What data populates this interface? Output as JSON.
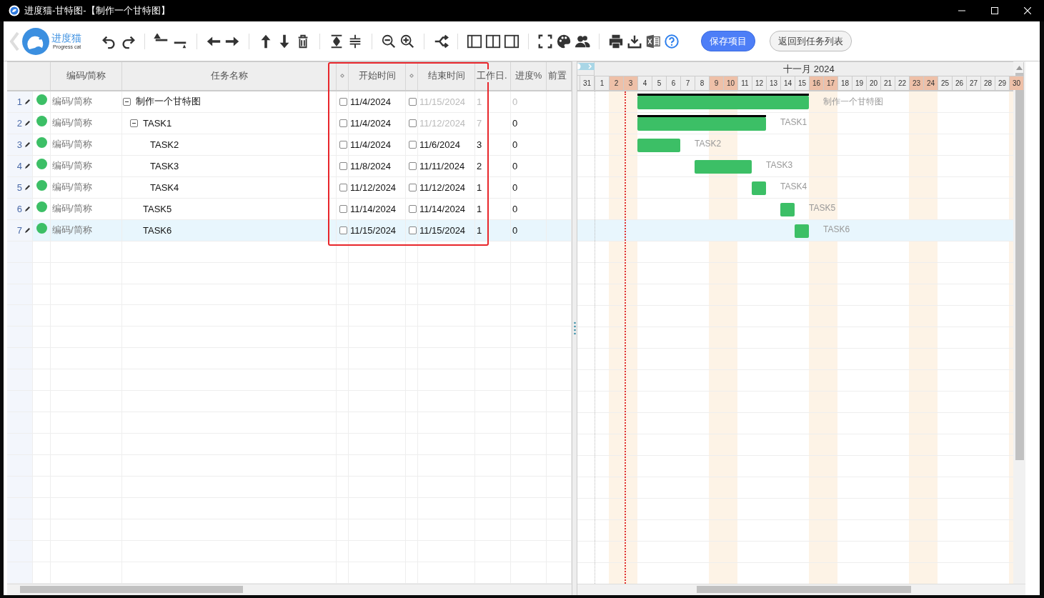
{
  "window": {
    "title": "进度猫-甘特图-【制作一个甘特图】"
  },
  "logo": {
    "name": "进度猫",
    "tagline": "Progress cat"
  },
  "buttons": [
    {
      "label": "保存项目",
      "kind": "primary"
    },
    {
      "label": "返回到任务列表",
      "kind": "secondary"
    }
  ],
  "columns": [
    "编码/简称",
    "任务名称",
    "开始时间",
    "结束时间",
    "工作日.",
    "进度%",
    "前置"
  ],
  "tasks": [
    {
      "no": "1",
      "code": "编码/简称",
      "name": "制作一个甘特图",
      "expanded": true,
      "selected": false,
      "start_checked": false,
      "start": "11/4/2024",
      "end_checked": false,
      "end": "11/15/2024",
      "workdays": "1",
      "progress": "0",
      "computed": true,
      "progress_muted": true,
      "bar_label": "制作一个甘特图",
      "children": [
        {
          "no": "2",
          "code": "编码/简称",
          "name": "TASK1",
          "expanded": true,
          "selected": false,
          "start_checked": false,
          "start": "11/4/2024",
          "end_checked": false,
          "end": "11/12/2024",
          "workdays": "7",
          "progress": "0",
          "computed": true,
          "progress_muted": false,
          "bar_label": "TASK1",
          "children": [
            {
              "no": "3",
              "code": "编码/简称",
              "name": "TASK2",
              "selected": false,
              "start_checked": false,
              "start": "11/4/2024",
              "end_checked": false,
              "end": "11/6/2024",
              "workdays": "3",
              "progress": "0",
              "computed": false,
              "progress_muted": false,
              "bar_label": "TASK2"
            },
            {
              "no": "4",
              "code": "编码/简称",
              "name": "TASK3",
              "selected": false,
              "start_checked": false,
              "start": "11/8/2024",
              "end_checked": false,
              "end": "11/11/2024",
              "workdays": "2",
              "progress": "0",
              "computed": false,
              "progress_muted": false,
              "bar_label": "TASK3"
            },
            {
              "no": "5",
              "code": "编码/简称",
              "name": "TASK4",
              "selected": false,
              "start_checked": false,
              "start": "11/12/2024",
              "end_checked": false,
              "end": "11/12/2024",
              "workdays": "1",
              "progress": "0",
              "computed": false,
              "progress_muted": false,
              "bar_label": "TASK4"
            }
          ]
        },
        {
          "no": "6",
          "code": "编码/简称",
          "name": "TASK5",
          "selected": false,
          "start_checked": false,
          "start": "11/14/2024",
          "end_checked": false,
          "end": "11/14/2024",
          "workdays": "1",
          "progress": "0",
          "computed": false,
          "progress_muted": false,
          "bar_label": "TASK5"
        },
        {
          "no": "7",
          "code": "编码/简称",
          "name": "TASK6",
          "selected": true,
          "start_checked": false,
          "start": "11/15/2024",
          "end_checked": false,
          "end": "11/15/2024",
          "workdays": "1",
          "progress": "0",
          "computed": false,
          "progress_muted": false,
          "bar_label": "TASK6"
        }
      ]
    }
  ],
  "timeline": {
    "month": "十一月 2024",
    "days": [
      {
        "label": "31",
        "weekend": false
      },
      {
        "label": "1",
        "weekend": false
      },
      {
        "label": "2",
        "weekend": true
      },
      {
        "label": "3",
        "weekend": true
      },
      {
        "label": "4",
        "weekend": false
      },
      {
        "label": "5",
        "weekend": false
      },
      {
        "label": "6",
        "weekend": false
      },
      {
        "label": "7",
        "weekend": false
      },
      {
        "label": "8",
        "weekend": false
      },
      {
        "label": "9",
        "weekend": true
      },
      {
        "label": "10",
        "weekend": true
      },
      {
        "label": "11",
        "weekend": false
      },
      {
        "label": "12",
        "weekend": false
      },
      {
        "label": "13",
        "weekend": false
      },
      {
        "label": "14",
        "weekend": false
      },
      {
        "label": "15",
        "weekend": false
      },
      {
        "label": "16",
        "weekend": true
      },
      {
        "label": "17",
        "weekend": true
      },
      {
        "label": "18",
        "weekend": false
      },
      {
        "label": "19",
        "weekend": false
      },
      {
        "label": "20",
        "weekend": false
      },
      {
        "label": "21",
        "weekend": false
      },
      {
        "label": "22",
        "weekend": false
      },
      {
        "label": "23",
        "weekend": true
      },
      {
        "label": "24",
        "weekend": true
      },
      {
        "label": "25",
        "weekend": false
      },
      {
        "label": "26",
        "weekend": false
      },
      {
        "label": "27",
        "weekend": false
      },
      {
        "label": "28",
        "weekend": false
      },
      {
        "label": "29",
        "weekend": false
      },
      {
        "label": "30",
        "weekend": true
      }
    ]
  }
}
